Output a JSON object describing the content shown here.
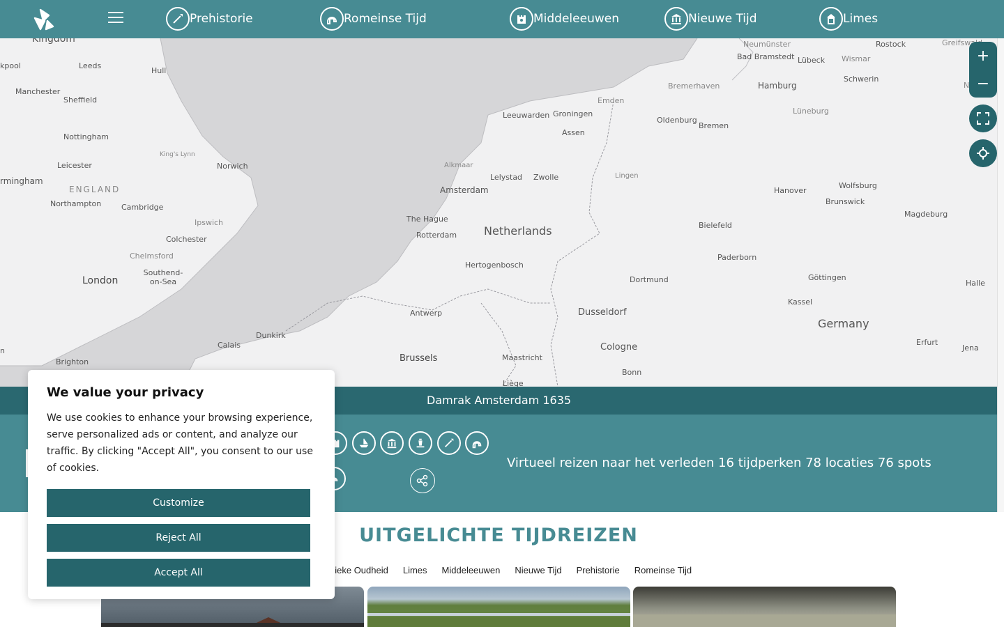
{
  "nav": {
    "items": [
      {
        "label": "Prehistorie",
        "icon": "spear-icon"
      },
      {
        "label": "Romeinse Tijd",
        "icon": "roman-helmet-icon"
      },
      {
        "label": "Middeleeuwen",
        "icon": "castle-icon"
      },
      {
        "label": "Nieuwe Tijd",
        "icon": "museum-icon"
      },
      {
        "label": "Limes",
        "icon": "watchtower-icon"
      }
    ]
  },
  "map": {
    "cities": [
      "Kingdom",
      "Leeds",
      "Hull",
      "kpool",
      "Manchester",
      "Sheffield",
      "Nottingham",
      "Leicester",
      "rmingham",
      "ENGLAND",
      "Northampton",
      "Cambridge",
      "King's Lynn",
      "Norwich",
      "Ipswich",
      "Colchester",
      "Chelmsford",
      "Southend-on-Sea",
      "London",
      "Brighton",
      "Calais",
      "Dunkirk",
      "Leeuwarden",
      "Groningen",
      "Assen",
      "Emden",
      "Oldenburg",
      "Bremen",
      "Bremerhaven",
      "Hamburg",
      "Lübeck",
      "Wismar",
      "Rostock",
      "Neumünster",
      "Bad Bramstedt",
      "Lüneburg",
      "Schwerin",
      "Greifswald",
      "Neubra",
      "Alkmaar",
      "Lelystad",
      "Zwolle",
      "Lingen",
      "Amsterdam",
      "The Hague",
      "Netherlands",
      "Rotterdam",
      "Hertogenbosch",
      "Antwerp",
      "Brussels",
      "Maastricht",
      "Liège",
      "Dortmund",
      "Dusseldorf",
      "Cologne",
      "Bonn",
      "Bielefeld",
      "Paderborn",
      "Hanover",
      "Brunswick",
      "Wolfsburg",
      "Magdeburg",
      "Göttingen",
      "Kassel",
      "Halle",
      "Germany",
      "Erfurt",
      "Jena",
      "n"
    ]
  },
  "map_controls": {
    "zoom_in": "+",
    "zoom_out": "−"
  },
  "strip": {
    "title": "Damrak Amsterdam 1635"
  },
  "band": {
    "tagline": "Virtueel reizen naar het verleden 16 tijdperken 78 locaties 76 spots"
  },
  "featured": {
    "title": "UITGELICHTE TIJDREIZEN",
    "filters": [
      "assieke Oudheid",
      "Limes",
      "Middeleeuwen",
      "Nieuwe Tijd",
      "Prehistorie",
      "Romeinse Tijd"
    ]
  },
  "cookie": {
    "title": "We value your privacy",
    "text": "We use cookies to enhance your browsing experience, serve personalized ads or content, and analyze our traffic. By clicking \"Accept All\", you consent to our use of cookies.",
    "customize": "Customize",
    "reject": "Reject All",
    "accept": "Accept All"
  },
  "colors": {
    "teal": "#478b93",
    "dark_teal": "#26656c",
    "strip": "#2a6870"
  }
}
